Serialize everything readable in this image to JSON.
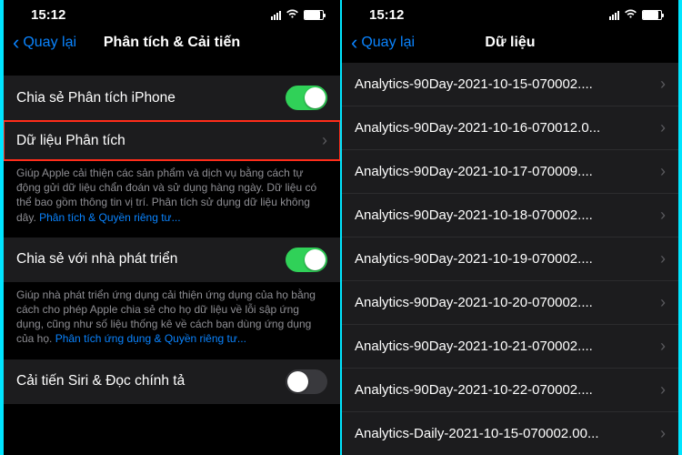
{
  "left": {
    "status": {
      "time": "15:12"
    },
    "nav": {
      "back": "Quay lại",
      "title": "Phân tích & Cải tiến"
    },
    "row_share_iphone": {
      "label": "Chia sẻ Phân tích iPhone",
      "on": true
    },
    "row_data": {
      "label": "Dữ liệu Phân tích"
    },
    "footer1_a": "Giúp Apple cải thiện các sản phẩm và dịch vụ bằng cách tự động gửi dữ liệu chẩn đoán và sử dụng hàng ngày. Dữ liệu có thể bao gồm thông tin vị trí. Phân tích sử dụng dữ liệu không dây. ",
    "footer1_link": "Phân tích & Quyền riêng tư...",
    "row_dev": {
      "label": "Chia sẻ với nhà phát triển",
      "on": true
    },
    "footer2_a": "Giúp nhà phát triển ứng dụng cải thiện ứng dụng của họ bằng cách cho phép Apple chia sẻ cho họ dữ liệu về lỗi sập ứng dụng, cũng như số liệu thống kê về cách bạn dùng ứng dụng của họ. ",
    "footer2_link": "Phân tích ứng dụng & Quyền riêng tư...",
    "row_siri": {
      "label": "Cải tiến Siri & Đọc chính tả",
      "on": false
    }
  },
  "right": {
    "status": {
      "time": "15:12"
    },
    "nav": {
      "back": "Quay lại",
      "title": "Dữ liệu"
    },
    "items": [
      "Analytics-90Day-2021-10-15-070002....",
      "Analytics-90Day-2021-10-16-070012.0...",
      "Analytics-90Day-2021-10-17-070009....",
      "Analytics-90Day-2021-10-18-070002....",
      "Analytics-90Day-2021-10-19-070002....",
      "Analytics-90Day-2021-10-20-070002....",
      "Analytics-90Day-2021-10-21-070002....",
      "Analytics-90Day-2021-10-22-070002....",
      "Analytics-Daily-2021-10-15-070002.00..."
    ]
  }
}
